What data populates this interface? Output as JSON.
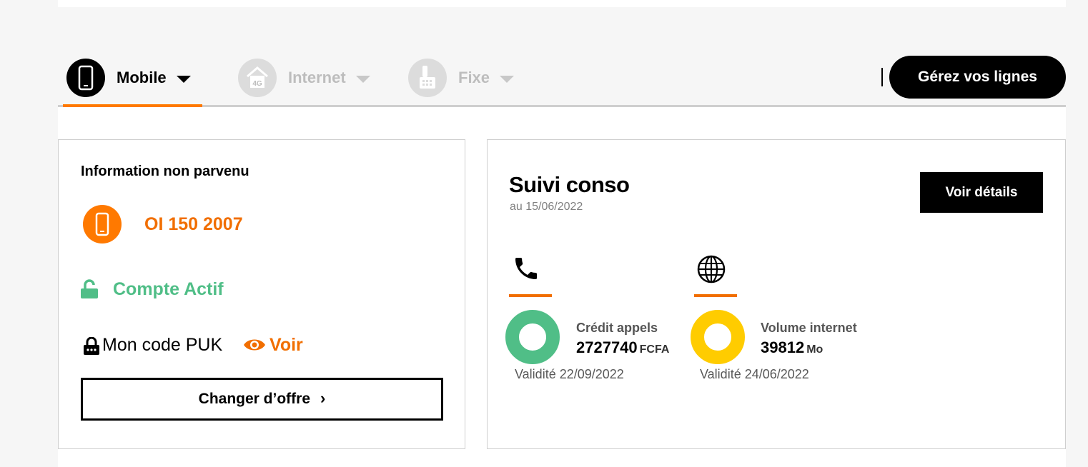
{
  "tabs": [
    {
      "label": "Mobile",
      "active": true,
      "icon": "smartphone-icon"
    },
    {
      "label": "Internet",
      "active": false,
      "icon": "home-4g-router-icon",
      "badge": "4G"
    },
    {
      "label": "Fixe",
      "active": false,
      "icon": "landline-phone-icon"
    }
  ],
  "header": {
    "manage_button": "Gérez vos lignes"
  },
  "line_card": {
    "title": "Information non parvenu",
    "line_number": "OI 150 2007",
    "status": "Compte Actif",
    "puk_label": "Mon code PUK",
    "puk_link": "Voir",
    "change_offer": "Changer d’offre"
  },
  "conso": {
    "title": "Suivi conso",
    "date": "au 15/06/2022",
    "details_button": "Voir détails",
    "metrics": [
      {
        "icon": "phone-icon",
        "label": "Crédit appels",
        "value": "2727740",
        "unit": "FCFA",
        "validity": "Validité 22/09/2022",
        "color": "#50be87"
      },
      {
        "icon": "globe-icon",
        "label": "Volume internet",
        "value": "39812",
        "unit": "Mo",
        "validity": "Validité 24/06/2022",
        "color": "#ffcc00"
      }
    ]
  },
  "colors": {
    "accent": "#ff7900",
    "success": "#50be87",
    "data": "#ffcc00",
    "text": "#000000"
  }
}
